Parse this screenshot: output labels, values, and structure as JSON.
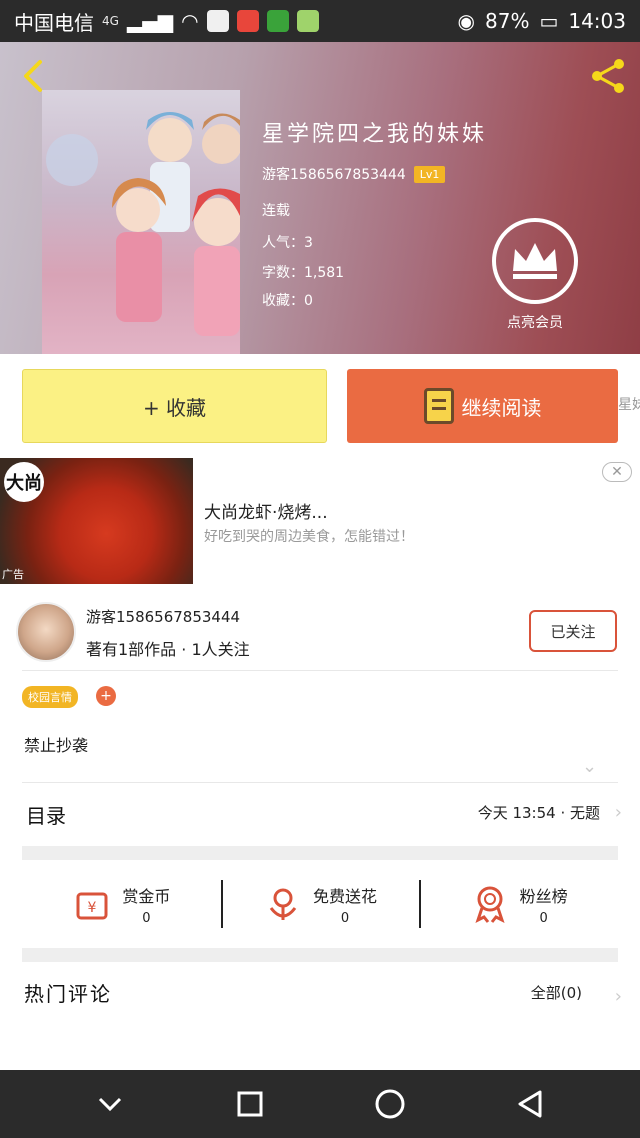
{
  "status_bar": {
    "carrier": "中国电信",
    "network": "4G",
    "battery": "87%",
    "time": "14:03"
  },
  "hero": {
    "title": "星学院四之我的妹妹",
    "author": "游客1586567853444",
    "level": "Lv1",
    "status": "连载",
    "popularity": "人气：3",
    "word_count": "字数：1,581",
    "collections": "收藏：0",
    "vip_label": "点亮会员"
  },
  "actions": {
    "favorite_label": "+ 收藏",
    "continue_label": "继续阅读",
    "peek_text": "星妹"
  },
  "ad": {
    "logo_text": "大尚",
    "title": "大尚龙虾·烧烤...",
    "description": "好吃到哭的周边美食，怎能错过！",
    "tag": "广告",
    "close": "✕"
  },
  "author_card": {
    "name": "游客1586567853444",
    "subtitle": "著有1部作品 · 1人关注",
    "follow_label": "已关注",
    "tag": "校园言情",
    "tag_add": "+",
    "description": "禁止抄袭",
    "expand": "⌄"
  },
  "toc": {
    "label": "目录",
    "latest": "今天 13:54 · 无题",
    "chevron": "›"
  },
  "stats": [
    {
      "label": "赏金币",
      "value": "0",
      "icon": "coin-icon"
    },
    {
      "label": "免费送花",
      "value": "0",
      "icon": "flower-icon"
    },
    {
      "label": "粉丝榜",
      "value": "0",
      "icon": "badge-icon"
    }
  ],
  "comments": {
    "label": "热门评论",
    "all": "全部(0)",
    "chevron": "›"
  },
  "colors": {
    "accent_orange": "#ea6b42",
    "button_yellow": "#fbf184",
    "level_gold": "#f2b524",
    "back_arrow": "#f5d81a"
  }
}
